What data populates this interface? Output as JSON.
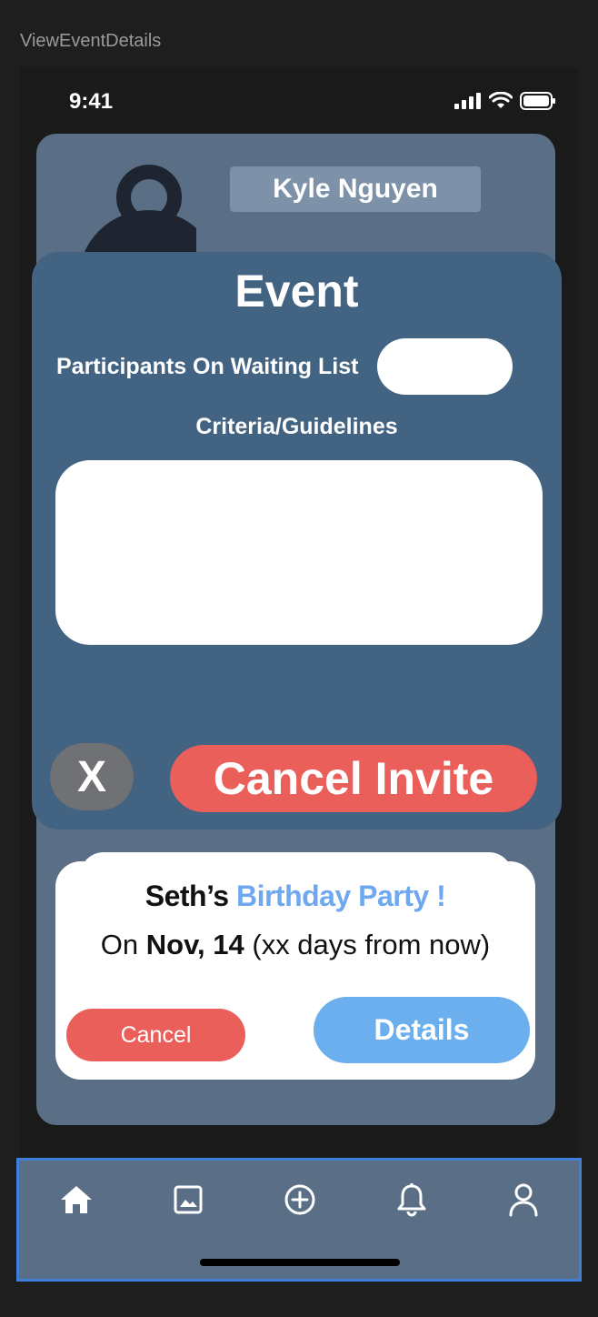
{
  "frame": {
    "label": "ViewEventDetails"
  },
  "status_bar": {
    "time": "9:41",
    "icons": [
      "cellular-signal-icon",
      "wifi-icon",
      "battery-icon"
    ]
  },
  "profile": {
    "name": "Kyle Nguyen",
    "avatar_icon": "person-icon"
  },
  "modal": {
    "title": "Event",
    "waitlist_label": "Participants On Waiting List",
    "waitlist_value": "",
    "criteria_label": "Criteria/Guidelines",
    "criteria_value": "",
    "close_label": "X",
    "cancel_invite_label": "Cancel Invite"
  },
  "event_card": {
    "host_prefix": "Seth’s",
    "event_name": "Birthday Party !",
    "date_prefix": "On",
    "date": "Nov, 14",
    "date_suffix": "(xx days from now)",
    "cancel_label": "Cancel",
    "details_label": "Details"
  },
  "tabbar": {
    "items": [
      {
        "name": "home",
        "icon": "home-icon"
      },
      {
        "name": "gallery",
        "icon": "image-icon"
      },
      {
        "name": "create",
        "icon": "plus-circle-icon"
      },
      {
        "name": "notifications",
        "icon": "bell-icon"
      },
      {
        "name": "profile",
        "icon": "user-icon"
      }
    ]
  },
  "colors": {
    "background": "#1e1e1e",
    "card": "#5a6e85",
    "modal": "#436383",
    "danger": "#eb5f5a",
    "accent": "#6fa8ee",
    "details": "#6bafef",
    "selection_outline": "#3d7fd9"
  }
}
